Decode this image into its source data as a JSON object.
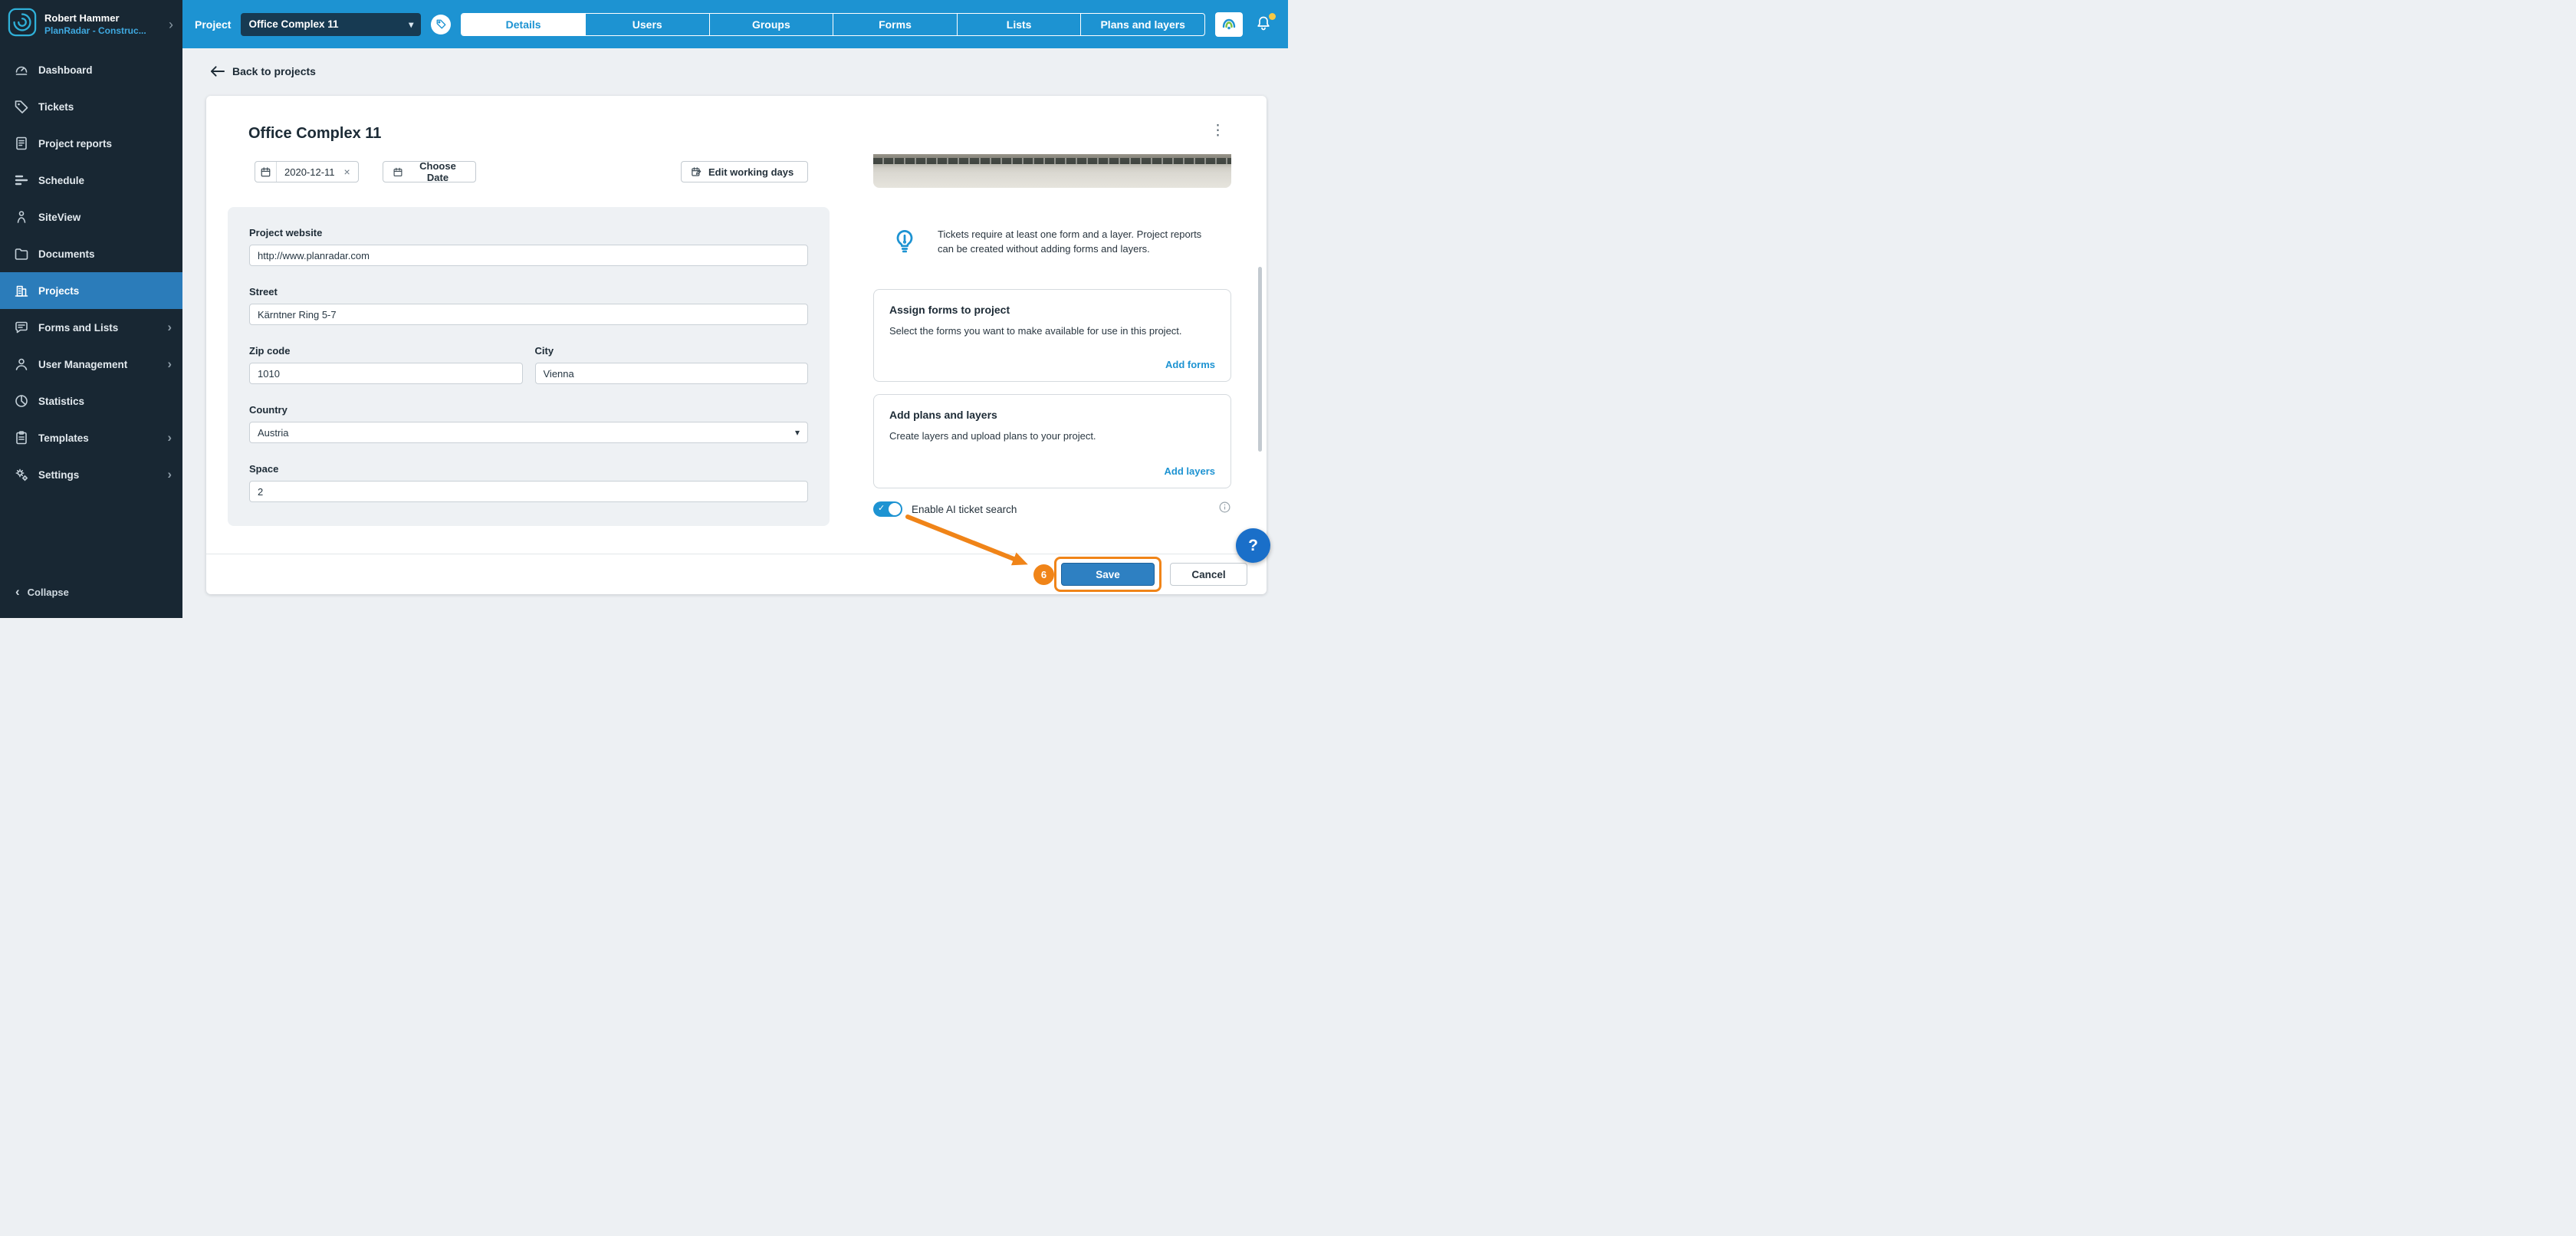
{
  "icons": {
    "chevron_right": "›",
    "chevron_left": "‹",
    "chevron_down": "▾",
    "close": "×",
    "kebab": "⋮",
    "check": "✓",
    "question": "?"
  },
  "sidebar": {
    "user_name": "Robert Hammer",
    "account_name": "PlanRadar - Construc...",
    "collapse_label": "Collapse",
    "items": [
      {
        "label": "Dashboard"
      },
      {
        "label": "Tickets"
      },
      {
        "label": "Project reports"
      },
      {
        "label": "Schedule"
      },
      {
        "label": "SiteView"
      },
      {
        "label": "Documents"
      },
      {
        "label": "Projects",
        "active": true
      },
      {
        "label": "Forms and Lists",
        "expandable": true
      },
      {
        "label": "User Management",
        "expandable": true
      },
      {
        "label": "Statistics"
      },
      {
        "label": "Templates",
        "expandable": true
      },
      {
        "label": "Settings",
        "expandable": true
      }
    ]
  },
  "topbar": {
    "project_label": "Project",
    "selected_project": "Office Complex 11",
    "tabs": [
      {
        "label": "Details",
        "active": true
      },
      {
        "label": "Users"
      },
      {
        "label": "Groups"
      },
      {
        "label": "Forms"
      },
      {
        "label": "Lists"
      },
      {
        "label": "Plans and layers"
      }
    ]
  },
  "content": {
    "back_link": "Back to projects",
    "card_title": "Office Complex 11",
    "toolbar": {
      "start_date": "2020-12-11",
      "choose_date_label": "Choose Date",
      "edit_working_days_label": "Edit working days"
    },
    "form": {
      "website_label": "Project website",
      "website_value": "http://www.planradar.com",
      "street_label": "Street",
      "street_value": "Kärntner Ring 5-7",
      "zip_label": "Zip code",
      "zip_value": "1010",
      "city_label": "City",
      "city_value": "Vienna",
      "country_label": "Country",
      "country_value": "Austria",
      "space_label": "Space",
      "space_value": "2"
    },
    "tip_text": "Tickets require at least one form and a layer. Project reports can be created without adding forms and layers.",
    "assign_forms_card": {
      "title": "Assign forms to project",
      "body": "Select the forms you want to make available for use in this project.",
      "link": "Add forms"
    },
    "plans_card": {
      "title": "Add plans and layers",
      "body": "Create layers and upload plans to your project.",
      "link": "Add layers"
    },
    "ai_toggle_label": "Enable AI ticket search",
    "footer": {
      "save_label": "Save",
      "cancel_label": "Cancel"
    },
    "annotation_step": "6"
  },
  "colors": {
    "topbar_blue": "#1d93d2",
    "sidebar_bg": "#182733",
    "active_item_blue": "#2b7cba",
    "accent_link": "#1d93d2",
    "annotation_orange": "#f08418",
    "help_blue": "#1a6fc9",
    "notification_dot": "#f6c945"
  }
}
